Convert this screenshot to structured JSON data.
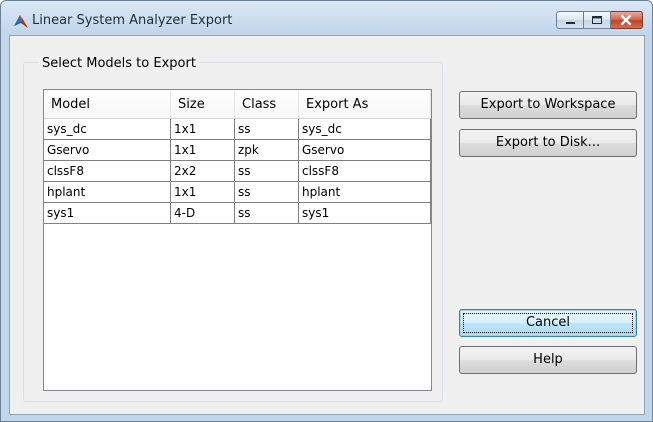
{
  "window": {
    "title": "Linear System Analyzer Export"
  },
  "group": {
    "title": "Select Models to Export"
  },
  "table": {
    "columns": [
      "Model",
      "Size",
      "Class",
      "Export As"
    ],
    "rows": [
      [
        "sys_dc",
        "1x1",
        "ss",
        "sys_dc"
      ],
      [
        "Gservo",
        "1x1",
        "zpk",
        "Gservo"
      ],
      [
        "clssF8",
        "2x2",
        "ss",
        "clssF8"
      ],
      [
        "hplant",
        "1x1",
        "ss",
        "hplant"
      ],
      [
        "sys1",
        "4-D",
        "ss",
        "sys1"
      ]
    ]
  },
  "buttons": {
    "export_workspace": "Export to Workspace",
    "export_disk": "Export to Disk...",
    "cancel": "Cancel",
    "help": "Help"
  },
  "icons": {
    "app": "matlab-logo-icon",
    "minimize": "minimize-icon",
    "maximize": "maximize-icon",
    "close": "close-icon"
  },
  "colors": {
    "title_bar": "#c3d7ec",
    "close_button": "#c0432a",
    "default_button": "#bee6fd"
  }
}
